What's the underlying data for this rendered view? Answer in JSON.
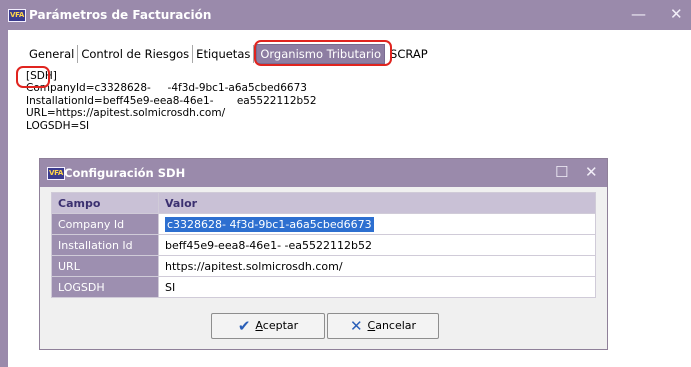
{
  "window": {
    "logo": "VFA",
    "title": "Parámetros de Facturación",
    "minimize": "—",
    "close": "✕"
  },
  "tabs": [
    {
      "label": "General"
    },
    {
      "label": "Control de Riesgos"
    },
    {
      "label": "Etiquetas"
    },
    {
      "label": "Organismo Tributario",
      "active": true
    },
    {
      "label": "SCRAP"
    }
  ],
  "config_text": {
    "section": "[SDH]",
    "lines": [
      "CompanyId=c3328628-     -4f3d-9bc1-a6a5cbed6673",
      "InstallationId=beff45e9-eea8-46e1-       ea5522112b52",
      "URL=https://apitest.solmicrosdh.com/",
      "LOGSDH=SI"
    ]
  },
  "dialog": {
    "logo": "VFA",
    "title": "Configuración SDH",
    "maximize": "☐",
    "close": "✕",
    "columns": [
      "Campo",
      "Valor"
    ],
    "rows": [
      {
        "field": "Company Id",
        "value": "c3328628-        4f3d-9bc1-a6a5cbed6673",
        "selected": true
      },
      {
        "field": "Installation Id",
        "value": "beff45e9-eea8-46e1-       -ea5522112b52"
      },
      {
        "field": "URL",
        "value": "https://apitest.solmicrosdh.com/"
      },
      {
        "field": "LOGSDH",
        "value": "SI"
      }
    ],
    "buttons": {
      "accept": {
        "mnemonic": "A",
        "rest": "ceptar",
        "icon": "checkmark-icon"
      },
      "cancel": {
        "mnemonic": "C",
        "rest": "ancelar",
        "icon": "x-icon"
      }
    }
  },
  "colors": {
    "titlebar": "#9a8aab",
    "highlight_red": "#e0241f",
    "selection": "#2d6fd0"
  }
}
